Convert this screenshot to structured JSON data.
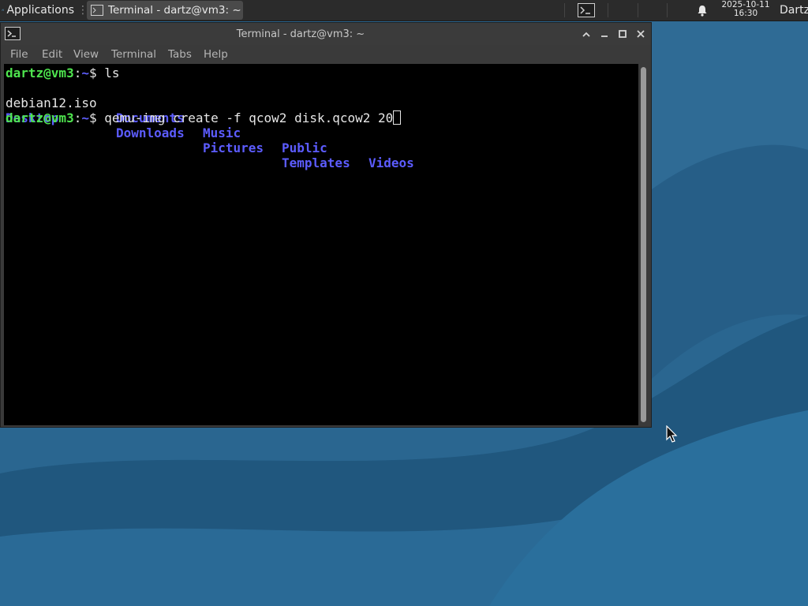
{
  "panel": {
    "applications_label": "Applications",
    "task_terminal_label": "Terminal - dartz@vm3: ~",
    "clock_date": "2025-10-11",
    "clock_time": "16:30",
    "user_label": "Dartz"
  },
  "window": {
    "title": "Terminal - dartz@vm3: ~",
    "menu": [
      "File",
      "Edit",
      "View",
      "Terminal",
      "Tabs",
      "Help"
    ]
  },
  "terminal": {
    "prompt_user": "dartz@vm3",
    "prompt_sep": ":",
    "prompt_path": "~",
    "prompt_dollar": "$ ",
    "cmd1": "ls",
    "ls_row1": {
      "file": "debian12.iso",
      "dirs": [
        "Documents",
        "Music",
        "Public",
        "Videos"
      ]
    },
    "ls_row2": {
      "dirs": [
        "Desktop",
        "Downloads",
        "Pictures",
        "Templates"
      ]
    },
    "cmd2": "qemu-img create -f qcow2 disk.qcow2 20"
  },
  "colors": {
    "prompt_user": "#4ee44e",
    "directory": "#5c5cff",
    "desktop": "#2a6690"
  }
}
